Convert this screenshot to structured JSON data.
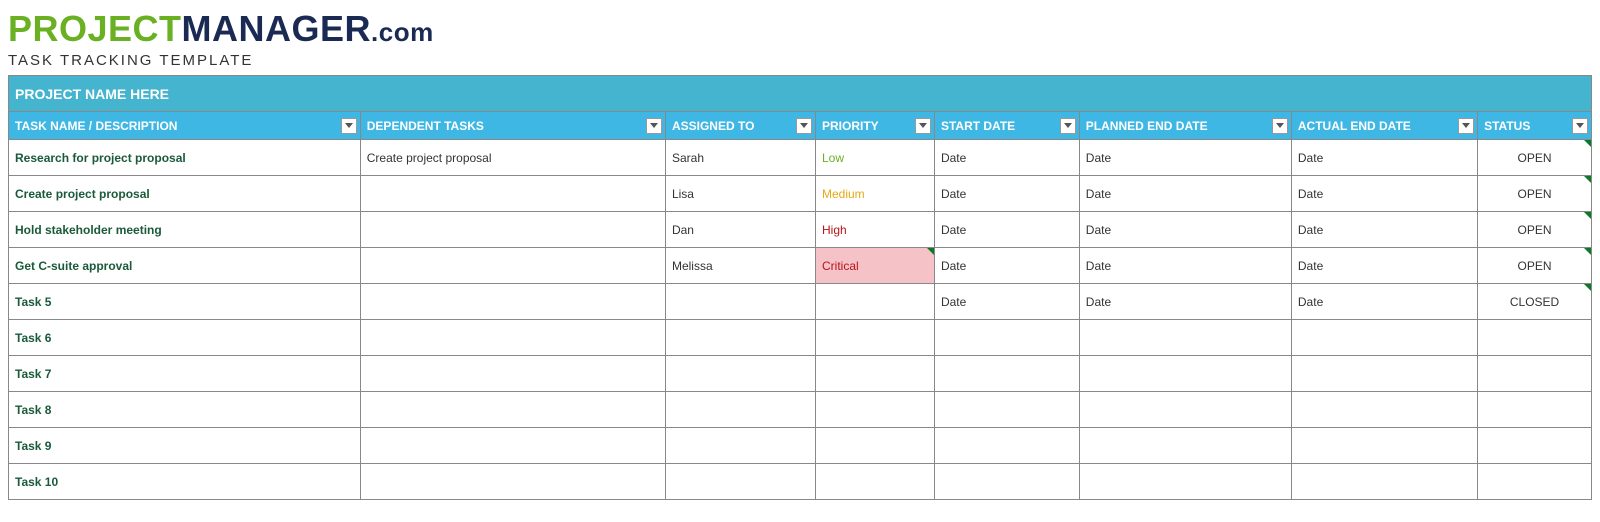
{
  "logo": {
    "part1": "PROJECT",
    "part2": "MANAGER",
    "part3": ".com"
  },
  "subtitle": "TASK TRACKING TEMPLATE",
  "project_name": "PROJECT NAME HERE",
  "columns": [
    {
      "key": "task",
      "label": "TASK NAME / DESCRIPTION"
    },
    {
      "key": "dep",
      "label": "DEPENDENT TASKS"
    },
    {
      "key": "assigned",
      "label": "ASSIGNED TO"
    },
    {
      "key": "priority",
      "label": "PRIORITY"
    },
    {
      "key": "start",
      "label": "START DATE"
    },
    {
      "key": "planned",
      "label": "PLANNED END DATE"
    },
    {
      "key": "actual",
      "label": "ACTUAL END DATE"
    },
    {
      "key": "status",
      "label": "STATUS"
    }
  ],
  "priority_styles": {
    "Low": "priority-low",
    "Medium": "priority-medium",
    "High": "priority-high",
    "Critical": "priority-critical"
  },
  "rows": [
    {
      "task": "Research for project proposal",
      "dep": "Create project proposal",
      "assigned": "Sarah",
      "priority": "Low",
      "start": "Date",
      "planned": "Date",
      "actual": "Date",
      "status": "OPEN",
      "ticks": [
        "status"
      ]
    },
    {
      "task": "Create project proposal",
      "dep": "",
      "assigned": "Lisa",
      "priority": "Medium",
      "start": "Date",
      "planned": "Date",
      "actual": "Date",
      "status": "OPEN",
      "ticks": [
        "status"
      ]
    },
    {
      "task": "Hold stakeholder meeting",
      "dep": "",
      "assigned": "Dan",
      "priority": "High",
      "start": "Date",
      "planned": "Date",
      "actual": "Date",
      "status": "OPEN",
      "ticks": [
        "status"
      ]
    },
    {
      "task": "Get C-suite approval",
      "dep": "",
      "assigned": "Melissa",
      "priority": "Critical",
      "start": "Date",
      "planned": "Date",
      "actual": "Date",
      "status": "OPEN",
      "ticks": [
        "priority",
        "status"
      ]
    },
    {
      "task": "Task 5",
      "dep": "",
      "assigned": "",
      "priority": "",
      "start": "Date",
      "planned": "Date",
      "actual": "Date",
      "status": "CLOSED",
      "ticks": [
        "status"
      ]
    },
    {
      "task": "Task 6",
      "dep": "",
      "assigned": "",
      "priority": "",
      "start": "",
      "planned": "",
      "actual": "",
      "status": "",
      "ticks": []
    },
    {
      "task": "Task 7",
      "dep": "",
      "assigned": "",
      "priority": "",
      "start": "",
      "planned": "",
      "actual": "",
      "status": "",
      "ticks": []
    },
    {
      "task": "Task 8",
      "dep": "",
      "assigned": "",
      "priority": "",
      "start": "",
      "planned": "",
      "actual": "",
      "status": "",
      "ticks": []
    },
    {
      "task": "Task 9",
      "dep": "",
      "assigned": "",
      "priority": "",
      "start": "",
      "planned": "",
      "actual": "",
      "status": "",
      "ticks": []
    },
    {
      "task": "Task 10",
      "dep": "",
      "assigned": "",
      "priority": "",
      "start": "",
      "planned": "",
      "actual": "",
      "status": "",
      "ticks": []
    }
  ]
}
